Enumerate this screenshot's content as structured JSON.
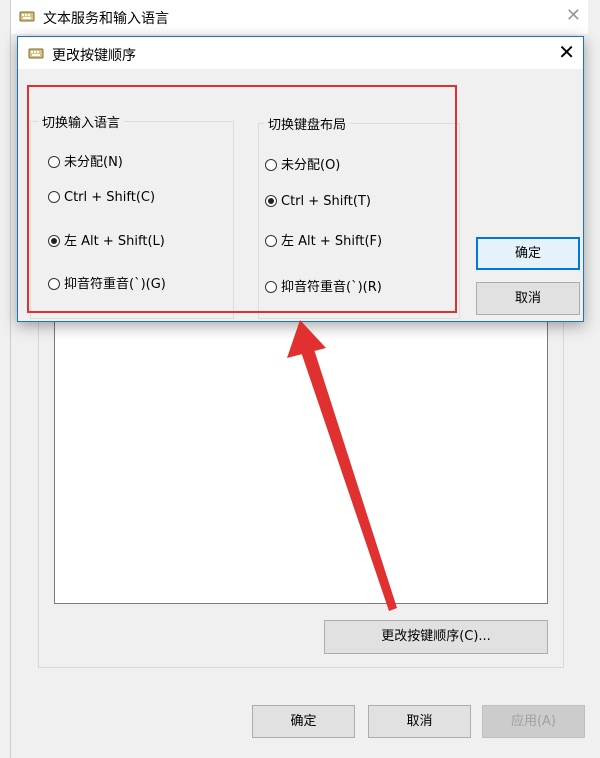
{
  "back_window": {
    "title": "文本服务和输入语言",
    "change_key_seq_button": "更改按键顺序(C)...",
    "ok_button": "确定",
    "cancel_button": "取消",
    "apply_button": "应用(A)"
  },
  "dialog": {
    "title": "更改按键顺序",
    "left_group": {
      "legend": "切换输入语言",
      "options": [
        {
          "label": "未分配(N)",
          "selected": false
        },
        {
          "label": "Ctrl + Shift(C)",
          "selected": false
        },
        {
          "label": "左 Alt + Shift(L)",
          "selected": true
        },
        {
          "label": "抑音符重音(`)(G)",
          "selected": false
        }
      ]
    },
    "right_group": {
      "legend": "切换键盘布局",
      "options": [
        {
          "label": "未分配(O)",
          "selected": false
        },
        {
          "label": "Ctrl + Shift(T)",
          "selected": true
        },
        {
          "label": "左 Alt + Shift(F)",
          "selected": false
        },
        {
          "label": "抑音符重音(`)(R)",
          "selected": false
        }
      ]
    },
    "ok_button": "确定",
    "cancel_button": "取消"
  },
  "colors": {
    "annotation_red": "#e03030",
    "focus_blue": "#0078d7"
  },
  "icons": [
    "keyboard-icon",
    "close-icon",
    "radio-button",
    "annotation-arrow"
  ]
}
